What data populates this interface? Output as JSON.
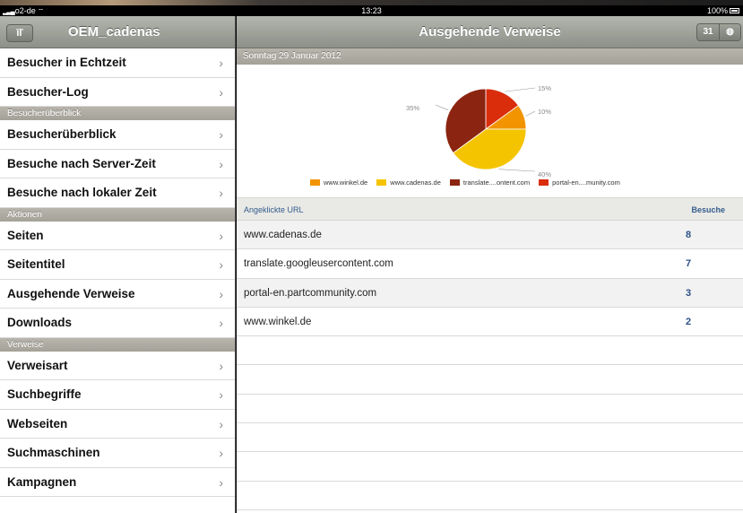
{
  "status_bar": {
    "carrier": "o2-de",
    "time": "13:23",
    "battery": "100%"
  },
  "master": {
    "title": "OEM_cadenas",
    "tools_icon": "tools-icon",
    "rows": [
      {
        "type": "row",
        "label": "Besucher in Echtzeit"
      },
      {
        "type": "row",
        "label": "Besucher-Log"
      },
      {
        "type": "section",
        "label": "Besucherüberblick"
      },
      {
        "type": "row",
        "label": "Besucherüberblick"
      },
      {
        "type": "row",
        "label": "Besuche nach Server-Zeit"
      },
      {
        "type": "row",
        "label": "Besuche nach lokaler Zeit"
      },
      {
        "type": "section",
        "label": "Aktionen"
      },
      {
        "type": "row",
        "label": "Seiten"
      },
      {
        "type": "row",
        "label": "Seitentitel"
      },
      {
        "type": "row",
        "label": "Ausgehende Verweise"
      },
      {
        "type": "row",
        "label": "Downloads"
      },
      {
        "type": "section",
        "label": "Verweise"
      },
      {
        "type": "row",
        "label": "Verweisart"
      },
      {
        "type": "row",
        "label": "Suchbegriffe"
      },
      {
        "type": "row",
        "label": "Webseiten"
      },
      {
        "type": "row",
        "label": "Suchmaschinen"
      },
      {
        "type": "row",
        "label": "Kampagnen"
      }
    ]
  },
  "detail": {
    "title": "Ausgehende Verweise",
    "calendar_label": "31",
    "date": "Sonntag 29 Januar 2012",
    "table": {
      "col_url": "Angeklickte URL",
      "col_visits": "Besuche",
      "rows": [
        {
          "url": "www.cadenas.de",
          "visits": "8"
        },
        {
          "url": "translate.googleusercontent.com",
          "visits": "7"
        },
        {
          "url": "portal-en.partcommunity.com",
          "visits": "3"
        },
        {
          "url": "www.winkel.de",
          "visits": "2"
        }
      ],
      "empty_rows": 6
    }
  },
  "chart_data": {
    "type": "pie",
    "slices": [
      {
        "name": "www.winkel.de",
        "value": 10,
        "label": "10%",
        "color": "#f29400"
      },
      {
        "name": "www.cadenas.de",
        "value": 40,
        "label": "40%",
        "color": "#f5c400"
      },
      {
        "name": "translate....ontent.com",
        "value": 35,
        "label": "35%",
        "color": "#8b2410"
      },
      {
        "name": "portal-en....munity.com",
        "value": 15,
        "label": "15%",
        "color": "#d92d0c"
      }
    ],
    "legend_position": "bottom"
  }
}
